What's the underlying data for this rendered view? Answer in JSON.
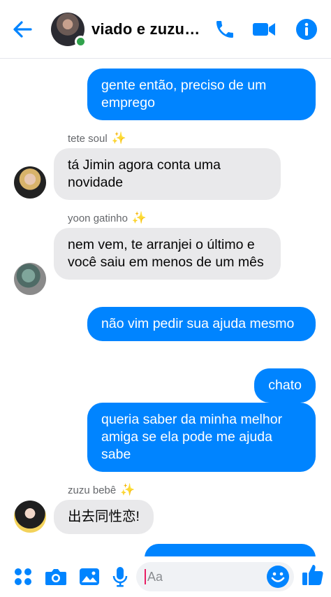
{
  "header": {
    "title": "viado e zuzuzi...",
    "back_icon": "arrow-left-icon",
    "call_icon": "phone-icon",
    "video_icon": "video-camera-icon",
    "info_icon": "info-icon",
    "accent": "#0084ff",
    "online_color": "#31a24c"
  },
  "messages": [
    {
      "side": "out",
      "text": "gente então, preciso de um emprego"
    },
    {
      "side": "in",
      "sender": "tete soul",
      "text": "tá Jimin agora conta uma novidade"
    },
    {
      "side": "in",
      "sender": "yoon gatinho",
      "text": "nem vem, te arranjei o último e você saiu em menos de um mês"
    },
    {
      "side": "out",
      "text": "não vim pedir sua ajuda mesmo"
    },
    {
      "side": "out",
      "text": "chato"
    },
    {
      "side": "out",
      "text": "queria saber da minha melhor amiga se ela pode me ajuda sabe"
    },
    {
      "side": "in",
      "sender": "zuzu bebê",
      "text": "出去同性恋!"
    }
  ],
  "composer": {
    "placeholder": "Aa",
    "icons": [
      "apps-icon",
      "camera-icon",
      "image-icon",
      "microphone-icon",
      "emoji-icon",
      "thumbs-up-icon"
    ]
  },
  "colors": {
    "outgoing_bubble": "#0084ff",
    "incoming_bubble": "#e9e9eb",
    "sparkle": "#f4c542"
  }
}
